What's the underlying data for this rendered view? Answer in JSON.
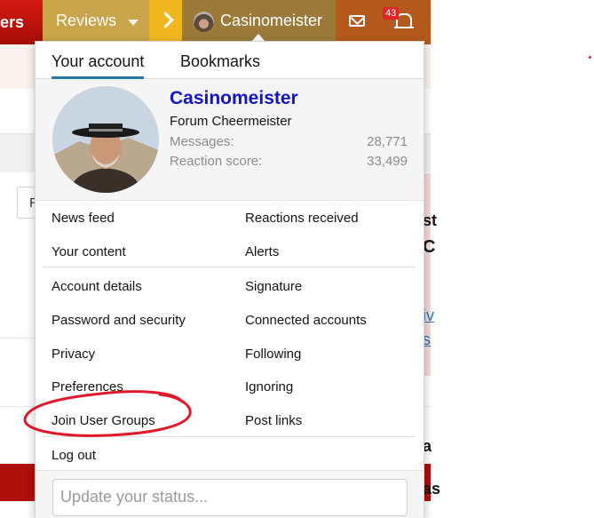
{
  "navbar": {
    "brand_fragment": "ers",
    "reviews_label": "Reviews",
    "username": "Casinomeister",
    "alerts_badge": "43",
    "colors": {
      "nav_red": "#b0100b",
      "reviews_gold": "#c8a44a",
      "arrow_yellow": "#f0b81e",
      "user_bg": "#9b7a3a"
    }
  },
  "menu": {
    "tabs": [
      {
        "label": "Your account",
        "active": true
      },
      {
        "label": "Bookmarks",
        "active": false
      }
    ],
    "profile": {
      "name": "Casinomeister",
      "title": "Forum Cheermeister",
      "messages_label": "Messages:",
      "messages_value": "28,771",
      "reaction_label": "Reaction score:",
      "reaction_value": "33,499"
    },
    "links_left": [
      "News feed",
      "Your content",
      "Account details",
      "Password and security",
      "Privacy",
      "Preferences",
      "Join User Groups"
    ],
    "links_right": [
      "Reactions received",
      "Alerts",
      "Signature",
      "Connected accounts",
      "Following",
      "Ignoring",
      "Post links"
    ],
    "logout_label": "Log out",
    "status_placeholder": "Update your status..."
  },
  "background": {
    "left_fragment": "R",
    "right_fragments": [
      "st",
      "C",
      "iv",
      "s",
      "a",
      "as"
    ]
  },
  "annotation": {
    "circle_color": "#e0192a",
    "circled_item": "Join User Groups"
  }
}
